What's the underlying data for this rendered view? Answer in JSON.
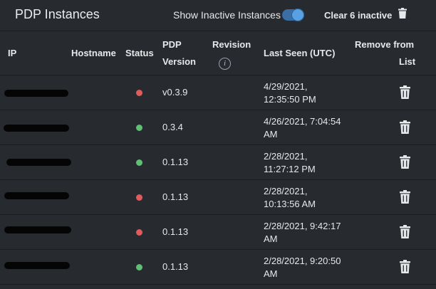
{
  "header": {
    "title": "PDP Instances",
    "show_inactive_label": "Show Inactive Instances",
    "show_inactive_enabled": true,
    "clear_label": "Clear 6 inactive"
  },
  "columns": {
    "ip": "IP",
    "hostname": "Hostname",
    "status": "Status",
    "version_line1": "PDP",
    "version_line2": "Version",
    "revision": "Revision",
    "revision_info_icon": "info-icon",
    "last_seen": "Last Seen (UTC)",
    "remove_line1": "Remove from",
    "remove_line2": "List"
  },
  "colors": {
    "status_active": "#5fbf72",
    "status_inactive": "#e05c5c"
  },
  "rows": [
    {
      "status": "inactive",
      "version": "v0.3.9",
      "seen1": "4/29/2021,",
      "seen2": "12:35:50 PM"
    },
    {
      "status": "active",
      "version": "0.3.4",
      "seen1": "4/26/2021, 7:04:54",
      "seen2": "AM"
    },
    {
      "status": "active",
      "version": "0.1.13",
      "seen1": "2/28/2021,",
      "seen2": "11:27:12 PM"
    },
    {
      "status": "inactive",
      "version": "0.1.13",
      "seen1": "2/28/2021,",
      "seen2": "10:13:56 AM"
    },
    {
      "status": "inactive",
      "version": "0.1.13",
      "seen1": "2/28/2021, 9:42:17",
      "seen2": "AM"
    },
    {
      "status": "active",
      "version": "0.1.13",
      "seen1": "2/28/2021, 9:20:50",
      "seen2": "AM"
    }
  ]
}
